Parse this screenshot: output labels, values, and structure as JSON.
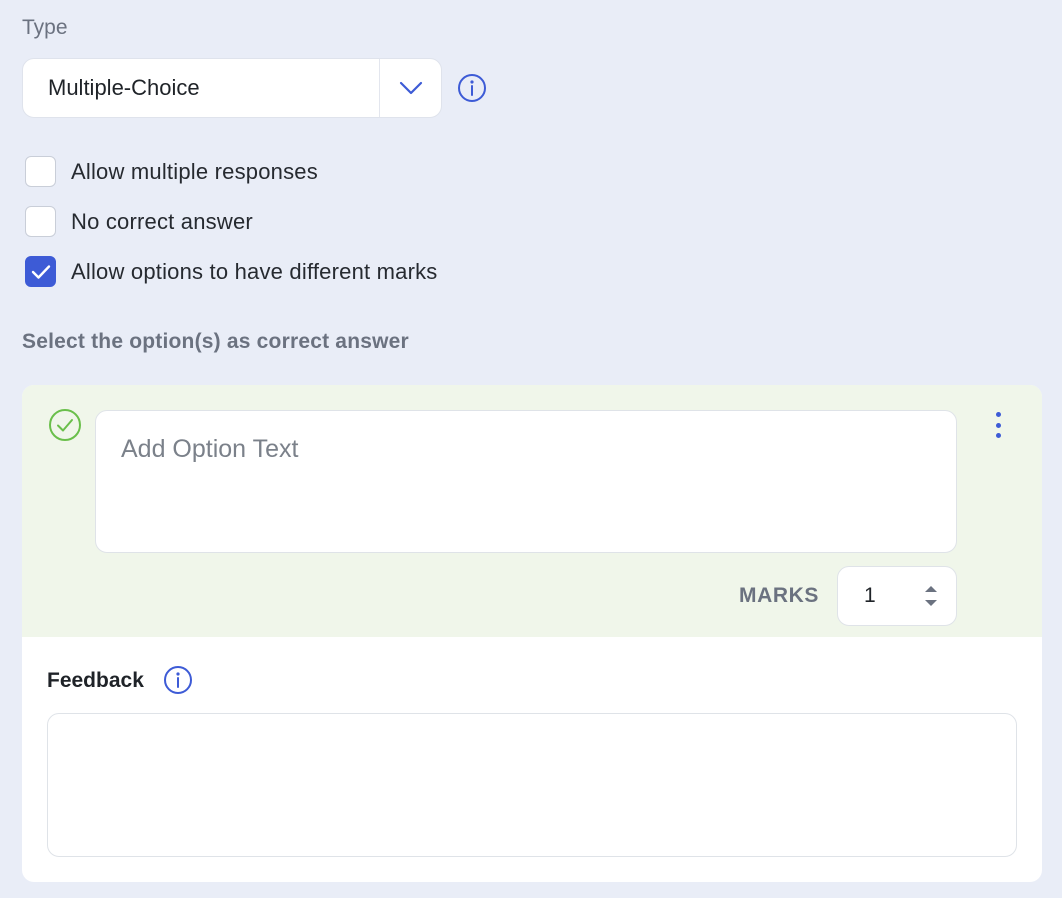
{
  "type_field": {
    "label": "Type",
    "value": "Multiple-Choice"
  },
  "options": [
    {
      "label": "Allow multiple responses",
      "checked": false
    },
    {
      "label": "No correct answer",
      "checked": false
    },
    {
      "label": "Allow options to have different marks",
      "checked": true
    }
  ],
  "section_title": "Select the option(s) as correct answer",
  "option_card": {
    "placeholder": "Add Option Text",
    "is_correct": true,
    "marks_label": "MARKS",
    "marks_value": "1",
    "feedback_label": "Feedback",
    "feedback_value": ""
  },
  "colors": {
    "accent": "#3d5bd6",
    "correct_green": "#6abf4b",
    "background": "#e9edf7",
    "correct_option_bg": "#f0f6ea"
  },
  "icons": [
    "chevron-down-icon",
    "info-icon",
    "check-icon",
    "check-circle-icon",
    "kebab-menu-icon",
    "stepper-up-icon",
    "stepper-down-icon"
  ]
}
